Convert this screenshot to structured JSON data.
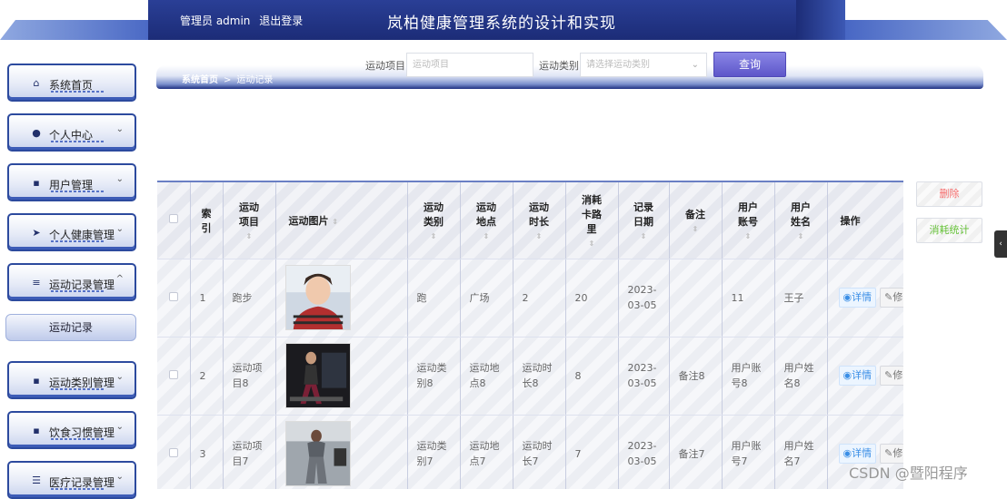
{
  "header": {
    "admin_label": "管理员 admin",
    "logout_label": "退出登录",
    "app_title": "岚柏健康管理系统的设计和实现"
  },
  "sidebar": {
    "items": [
      {
        "label": "系统首页",
        "icon": "home-icon",
        "glyph": "⌂",
        "has_chevron": false
      },
      {
        "label": "个人中心",
        "icon": "user-icon",
        "glyph": "●",
        "has_chevron": true
      },
      {
        "label": "用户管理",
        "icon": "grid-icon",
        "glyph": "▪",
        "has_chevron": true
      },
      {
        "label": "个人健康管理",
        "icon": "send-icon",
        "glyph": "➤",
        "has_chevron": true
      },
      {
        "label": "运动记录管理",
        "icon": "list-icon",
        "glyph": "≡",
        "has_chevron": true,
        "expanded": true
      },
      {
        "label": "运动类别管理",
        "icon": "grid-icon",
        "glyph": "▪",
        "has_chevron": true
      },
      {
        "label": "饮食习惯管理",
        "icon": "grid-icon",
        "glyph": "▪",
        "has_chevron": true
      },
      {
        "label": "医疗记录管理",
        "icon": "sliders-icon",
        "glyph": "☰",
        "has_chevron": true
      }
    ],
    "sub_item": "运动记录",
    "chevron_down": "⌄",
    "chevron_up": "^"
  },
  "breadcrumb": {
    "home": "系统首页",
    "separator": ">",
    "current": "运动记录"
  },
  "search": {
    "project_label": "运动项目",
    "project_placeholder": "运动项目",
    "category_label": "运动类别",
    "category_placeholder": "请选择运动类别",
    "query_button": "查询"
  },
  "actions": {
    "delete": "删除",
    "stats": "消耗统计"
  },
  "table": {
    "headers": {
      "index": "索引",
      "project": "运动项目",
      "image": "运动图片",
      "category": "运动类别",
      "location": "运动地点",
      "duration": "运动时长",
      "calories": "消耗卡路里",
      "date": "记录日期",
      "remark": "备注",
      "account": "用户账号",
      "name": "用户姓名",
      "operation": "操作"
    },
    "rows": [
      {
        "index": "1",
        "project": "跑步",
        "category": "跑",
        "location": "广场",
        "duration": "2",
        "calories": "20",
        "date": "2023-03-05",
        "remark": "",
        "account": "11",
        "name": "王子",
        "image": "portrait-photo"
      },
      {
        "index": "2",
        "project": "运动项目8",
        "category": "运动类别8",
        "location": "运动地点8",
        "duration": "运动时长8",
        "calories": "8",
        "date": "2023-03-05",
        "remark": "备注8",
        "account": "用户账号8",
        "name": "用户姓名8",
        "image": "treadmill-photo"
      },
      {
        "index": "3",
        "project": "运动项目7",
        "category": "运动类别7",
        "location": "运动地点7",
        "duration": "运动时长7",
        "calories": "7",
        "date": "2023-03-05",
        "remark": "备注7",
        "account": "用户账号7",
        "name": "用户姓名7",
        "image": "gym-photo"
      }
    ],
    "detail_label": "详情",
    "edit_label": "修"
  },
  "watermark": "CSDN @暨阳程序",
  "colors": {
    "header_blue": "#1c2c77",
    "accent_purple": "#5d56c9",
    "delete_red": "#f56c6c",
    "stats_green": "#67c23a",
    "detail_blue": "#3a8ee6"
  }
}
